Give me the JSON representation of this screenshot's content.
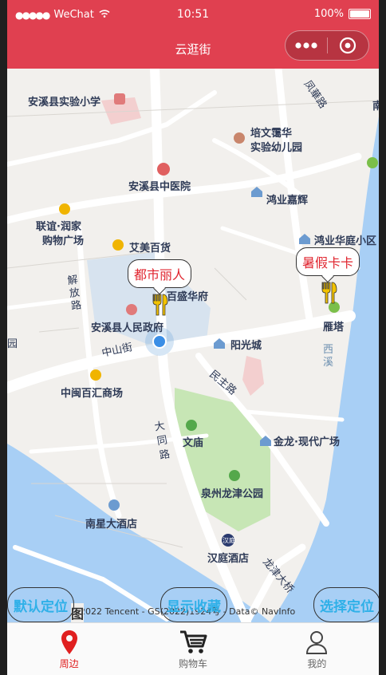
{
  "status_bar": {
    "signal": "●●●●●",
    "carrier": "WeChat",
    "time": "10:51",
    "battery": "100%"
  },
  "nav": {
    "title": "云逛街"
  },
  "map": {
    "pois": [
      {
        "label": "安溪县实验小学"
      },
      {
        "label": "培文霭华"
      },
      {
        "label": "实验幼儿园"
      },
      {
        "label": "安溪县中医院"
      },
      {
        "label": "鸿业嘉辉"
      },
      {
        "label": "联谊·润家"
      },
      {
        "label": "购物广场"
      },
      {
        "label": "艾美百货"
      },
      {
        "label": "鸿业华庭小区"
      },
      {
        "label": "百盛华府"
      },
      {
        "label": "安溪县人民政府"
      },
      {
        "label": "雁塔"
      },
      {
        "label": "阳光城"
      },
      {
        "label": "中山街"
      },
      {
        "label": "解放路"
      },
      {
        "label": "中闽百汇商场"
      },
      {
        "label": "民主路"
      },
      {
        "label": "大同路"
      },
      {
        "label": "文庙"
      },
      {
        "label": "金龙·现代广场"
      },
      {
        "label": "泉州龙津公园"
      },
      {
        "label": "南星大酒店"
      },
      {
        "label": "汉庭酒店"
      },
      {
        "label": "龙津大桥"
      },
      {
        "label": "凤華路"
      },
      {
        "label": "西溪"
      },
      {
        "label": "园"
      },
      {
        "label": "南"
      },
      {
        "label": "汉庭"
      }
    ],
    "markers": [
      {
        "label": "都市丽人"
      },
      {
        "label": "暑假卡卡"
      }
    ],
    "copyright": "©2022 Tencent - GS(2022)1924号 - Data© NavInfo",
    "logo": "图"
  },
  "actions": {
    "default_location": "默认定位",
    "show_favorites": "显示收藏",
    "choose_location": "选择定位"
  },
  "tabbar": [
    {
      "label": "周边",
      "icon": "location-pin-icon",
      "active": true
    },
    {
      "label": "购物车",
      "icon": "cart-icon",
      "active": false
    },
    {
      "label": "我的",
      "icon": "user-icon",
      "active": false
    }
  ],
  "colors": {
    "brand": "#e04050",
    "water": "#a8cff5",
    "park": "#c7e6b5",
    "active_tab": "#e02020",
    "action_text": "#2fb0e8"
  }
}
